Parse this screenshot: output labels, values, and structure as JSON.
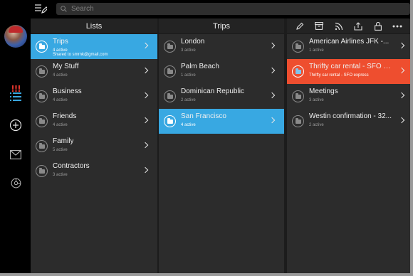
{
  "search": {
    "placeholder": "Search"
  },
  "rail": {
    "priority_label": "!!!"
  },
  "lists": {
    "header": "Lists",
    "items": [
      {
        "title": "Trips",
        "sub": "4 active",
        "sub2": "Shared to smrnk@gmail.com",
        "state": "active"
      },
      {
        "title": "My Stuff",
        "sub": "4 active"
      },
      {
        "title": "Business",
        "sub": "4 active"
      },
      {
        "title": "Friends",
        "sub": "4 active"
      },
      {
        "title": "Family",
        "sub": "5 active"
      },
      {
        "title": "Contractors",
        "sub": "3 active"
      }
    ]
  },
  "trips": {
    "header": "Trips",
    "items": [
      {
        "title": "London",
        "sub": "3 active"
      },
      {
        "title": "Palm Beach",
        "sub": "1 active"
      },
      {
        "title": "Dominican Republic",
        "sub": "2 active"
      },
      {
        "title": "San Francisco",
        "sub": "4 active",
        "state": "active"
      }
    ]
  },
  "tasks": {
    "toolbar": [
      "edit-icon",
      "archive-icon",
      "rss-icon",
      "share-icon",
      "lock-icon",
      "more-icon"
    ],
    "items": [
      {
        "title": "American Airlines JFK -...",
        "sub": "1 active"
      },
      {
        "title": "Thrifty car rental - SFO e...",
        "sub": "Thrifty car rental - SFO express",
        "state": "alert"
      },
      {
        "title": "Meetings",
        "sub": "3 active"
      },
      {
        "title": "Westin confirmation - 32...",
        "sub": "2 active"
      }
    ]
  },
  "colors": {
    "active": "#38a8e2",
    "alert": "#ee4e2f",
    "priority": "#e0342c"
  }
}
